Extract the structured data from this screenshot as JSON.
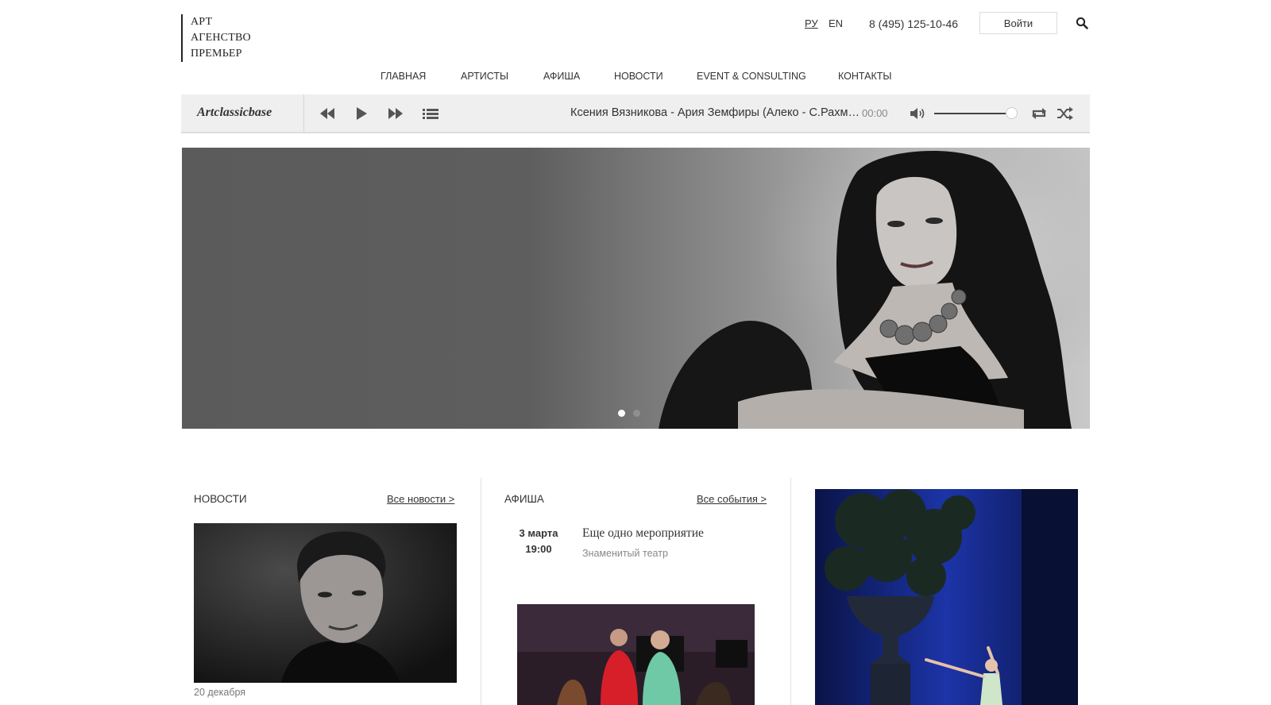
{
  "logo": {
    "lines": [
      "АРТ",
      "АГЕНСТВО",
      "ПРЕМЬЕР"
    ]
  },
  "header": {
    "lang_ru": "РУ",
    "lang_en": "EN",
    "phone": "8 (495) 125-10-46",
    "login_label": "Войти",
    "search_icon": "search-icon"
  },
  "nav": {
    "items": [
      "ГЛАВНАЯ",
      "АРТИСТЫ",
      "АФИША",
      "НОВОСТИ",
      "EVENT & CONSULTING",
      "КОНТАКТЫ"
    ]
  },
  "player": {
    "brand": "Artclassicbase",
    "track": "Ксения Вязникова - Ария Земфиры (Алеко - С.Рахманинов)",
    "time": "00:00",
    "volume_percent": 100,
    "icons": [
      "rewind-icon",
      "play-icon",
      "forward-icon",
      "playlist-icon",
      "volume-icon",
      "repeat-icon",
      "shuffle-icon"
    ]
  },
  "hero": {
    "slides_count": 2,
    "active_slide": 1
  },
  "news": {
    "title": "НОВОСТИ",
    "all_link": "Все новости >",
    "item_date": "20 декабря"
  },
  "afisha": {
    "title": "АФИША",
    "all_link": "Все события >",
    "event": {
      "date": "3 марта",
      "time": "19:00",
      "title": "Еще одно мероприятие",
      "venue": "Знаменитый театр"
    }
  },
  "colors": {
    "text": "#333333",
    "player_bg": "#efefef",
    "hero_dark": "#5b5b5b",
    "stage_blue": "#0f1c5e"
  }
}
